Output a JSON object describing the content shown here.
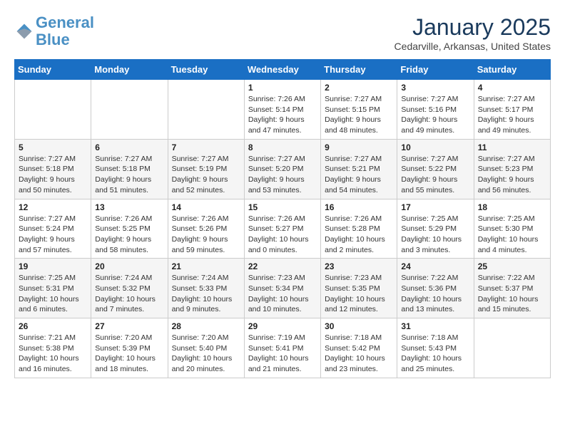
{
  "logo": {
    "line1": "General",
    "line2": "Blue"
  },
  "title": "January 2025",
  "subtitle": "Cedarville, Arkansas, United States",
  "weekdays": [
    "Sunday",
    "Monday",
    "Tuesday",
    "Wednesday",
    "Thursday",
    "Friday",
    "Saturday"
  ],
  "weeks": [
    [
      {
        "day": "",
        "info": ""
      },
      {
        "day": "",
        "info": ""
      },
      {
        "day": "",
        "info": ""
      },
      {
        "day": "1",
        "info": "Sunrise: 7:26 AM\nSunset: 5:14 PM\nDaylight: 9 hours and 47 minutes."
      },
      {
        "day": "2",
        "info": "Sunrise: 7:27 AM\nSunset: 5:15 PM\nDaylight: 9 hours and 48 minutes."
      },
      {
        "day": "3",
        "info": "Sunrise: 7:27 AM\nSunset: 5:16 PM\nDaylight: 9 hours and 49 minutes."
      },
      {
        "day": "4",
        "info": "Sunrise: 7:27 AM\nSunset: 5:17 PM\nDaylight: 9 hours and 49 minutes."
      }
    ],
    [
      {
        "day": "5",
        "info": "Sunrise: 7:27 AM\nSunset: 5:18 PM\nDaylight: 9 hours and 50 minutes."
      },
      {
        "day": "6",
        "info": "Sunrise: 7:27 AM\nSunset: 5:18 PM\nDaylight: 9 hours and 51 minutes."
      },
      {
        "day": "7",
        "info": "Sunrise: 7:27 AM\nSunset: 5:19 PM\nDaylight: 9 hours and 52 minutes."
      },
      {
        "day": "8",
        "info": "Sunrise: 7:27 AM\nSunset: 5:20 PM\nDaylight: 9 hours and 53 minutes."
      },
      {
        "day": "9",
        "info": "Sunrise: 7:27 AM\nSunset: 5:21 PM\nDaylight: 9 hours and 54 minutes."
      },
      {
        "day": "10",
        "info": "Sunrise: 7:27 AM\nSunset: 5:22 PM\nDaylight: 9 hours and 55 minutes."
      },
      {
        "day": "11",
        "info": "Sunrise: 7:27 AM\nSunset: 5:23 PM\nDaylight: 9 hours and 56 minutes."
      }
    ],
    [
      {
        "day": "12",
        "info": "Sunrise: 7:27 AM\nSunset: 5:24 PM\nDaylight: 9 hours and 57 minutes."
      },
      {
        "day": "13",
        "info": "Sunrise: 7:26 AM\nSunset: 5:25 PM\nDaylight: 9 hours and 58 minutes."
      },
      {
        "day": "14",
        "info": "Sunrise: 7:26 AM\nSunset: 5:26 PM\nDaylight: 9 hours and 59 minutes."
      },
      {
        "day": "15",
        "info": "Sunrise: 7:26 AM\nSunset: 5:27 PM\nDaylight: 10 hours and 0 minutes."
      },
      {
        "day": "16",
        "info": "Sunrise: 7:26 AM\nSunset: 5:28 PM\nDaylight: 10 hours and 2 minutes."
      },
      {
        "day": "17",
        "info": "Sunrise: 7:25 AM\nSunset: 5:29 PM\nDaylight: 10 hours and 3 minutes."
      },
      {
        "day": "18",
        "info": "Sunrise: 7:25 AM\nSunset: 5:30 PM\nDaylight: 10 hours and 4 minutes."
      }
    ],
    [
      {
        "day": "19",
        "info": "Sunrise: 7:25 AM\nSunset: 5:31 PM\nDaylight: 10 hours and 6 minutes."
      },
      {
        "day": "20",
        "info": "Sunrise: 7:24 AM\nSunset: 5:32 PM\nDaylight: 10 hours and 7 minutes."
      },
      {
        "day": "21",
        "info": "Sunrise: 7:24 AM\nSunset: 5:33 PM\nDaylight: 10 hours and 9 minutes."
      },
      {
        "day": "22",
        "info": "Sunrise: 7:23 AM\nSunset: 5:34 PM\nDaylight: 10 hours and 10 minutes."
      },
      {
        "day": "23",
        "info": "Sunrise: 7:23 AM\nSunset: 5:35 PM\nDaylight: 10 hours and 12 minutes."
      },
      {
        "day": "24",
        "info": "Sunrise: 7:22 AM\nSunset: 5:36 PM\nDaylight: 10 hours and 13 minutes."
      },
      {
        "day": "25",
        "info": "Sunrise: 7:22 AM\nSunset: 5:37 PM\nDaylight: 10 hours and 15 minutes."
      }
    ],
    [
      {
        "day": "26",
        "info": "Sunrise: 7:21 AM\nSunset: 5:38 PM\nDaylight: 10 hours and 16 minutes."
      },
      {
        "day": "27",
        "info": "Sunrise: 7:20 AM\nSunset: 5:39 PM\nDaylight: 10 hours and 18 minutes."
      },
      {
        "day": "28",
        "info": "Sunrise: 7:20 AM\nSunset: 5:40 PM\nDaylight: 10 hours and 20 minutes."
      },
      {
        "day": "29",
        "info": "Sunrise: 7:19 AM\nSunset: 5:41 PM\nDaylight: 10 hours and 21 minutes."
      },
      {
        "day": "30",
        "info": "Sunrise: 7:18 AM\nSunset: 5:42 PM\nDaylight: 10 hours and 23 minutes."
      },
      {
        "day": "31",
        "info": "Sunrise: 7:18 AM\nSunset: 5:43 PM\nDaylight: 10 hours and 25 minutes."
      },
      {
        "day": "",
        "info": ""
      }
    ]
  ]
}
